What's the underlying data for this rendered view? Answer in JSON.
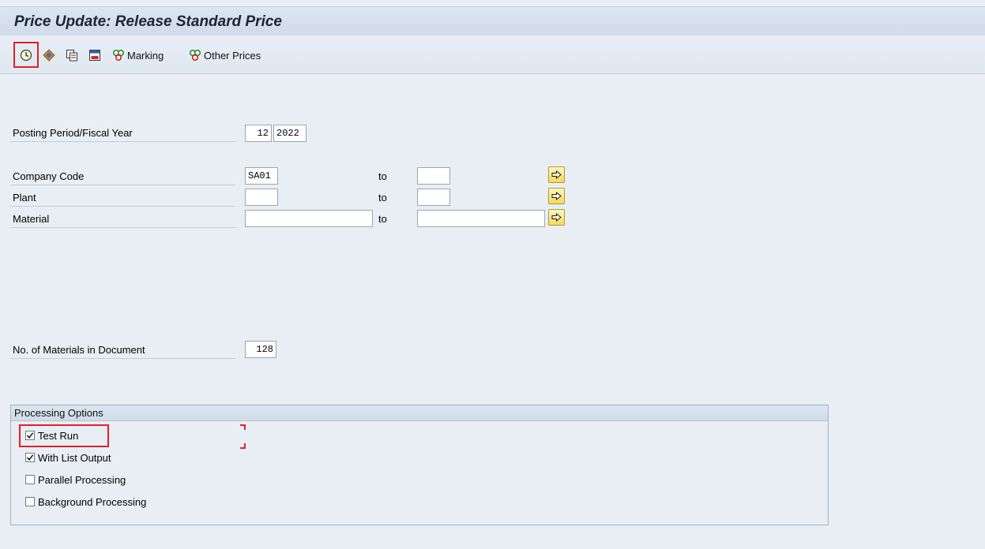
{
  "window": {
    "title": "Price Update: Release Standard Price"
  },
  "toolbar": {
    "execute": {
      "icon": "execute-icon"
    },
    "icon2": {
      "icon": "variant-icon"
    },
    "icon3": {
      "icon": "copy-icon"
    },
    "icon4": {
      "icon": "save-variant-icon"
    },
    "marking": {
      "icon": "marking-icon",
      "label": "Marking"
    },
    "other_prices": {
      "icon": "other-prices-icon",
      "label": "Other Prices"
    }
  },
  "form": {
    "posting_period": {
      "label": "Posting Period/Fiscal Year",
      "period": "12",
      "year": "2022"
    },
    "company_code": {
      "label": "Company Code",
      "from": "SA01",
      "to_label": "to",
      "to": ""
    },
    "plant": {
      "label": "Plant",
      "from": "",
      "to_label": "to",
      "to": ""
    },
    "material": {
      "label": "Material",
      "from": "",
      "to_label": "to",
      "to": ""
    },
    "no_materials": {
      "label": "No. of Materials in Document",
      "value": "128"
    }
  },
  "processing_options": {
    "title": "Processing Options",
    "items": [
      {
        "label": "Test Run",
        "checked": true
      },
      {
        "label": "With List Output",
        "checked": true
      },
      {
        "label": "Parallel Processing",
        "checked": false
      },
      {
        "label": "Background Processing",
        "checked": false
      }
    ]
  },
  "colors": {
    "highlight": "#e0202a",
    "title_text": "#1b2533",
    "background": "#e9eef4"
  }
}
